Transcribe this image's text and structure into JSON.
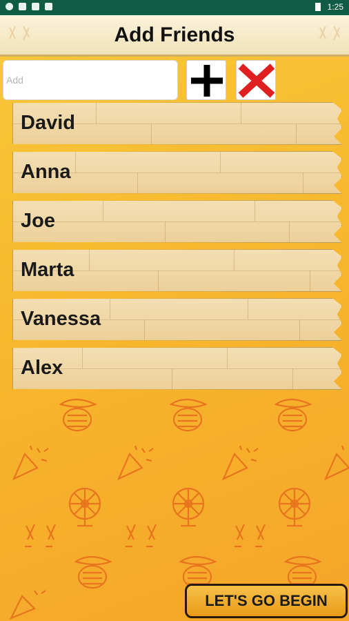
{
  "status_bar": {
    "time": "1:25"
  },
  "header": {
    "title": "Add Friends"
  },
  "add_row": {
    "placeholder": "Add"
  },
  "friends": [
    "David",
    "Anna",
    "Joe",
    "Marta",
    "Vanessa",
    "Alex"
  ],
  "footer": {
    "begin_label": "LET'S GO BEGIN"
  },
  "colors": {
    "accent": "#f7b42c",
    "status_bar": "#0f5b44",
    "clear_x": "#e02020",
    "pattern_line": "#e8741e"
  },
  "icons": [
    "plus-icon",
    "close-x-icon",
    "confetti-icon",
    "wheel-icon",
    "crocodile-icon",
    "cheers-icon"
  ]
}
